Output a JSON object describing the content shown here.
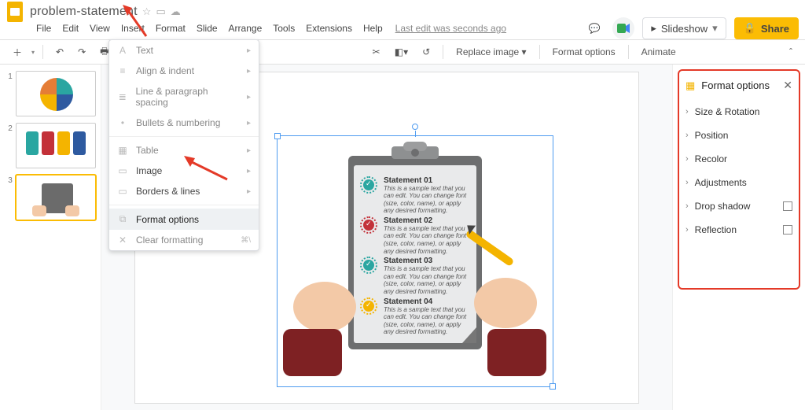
{
  "doc": {
    "title": "problem-statement",
    "last_edit": "Last edit was seconds ago"
  },
  "menubar": [
    "File",
    "Edit",
    "View",
    "Insert",
    "Format",
    "Slide",
    "Arrange",
    "Tools",
    "Extensions",
    "Help"
  ],
  "actions": {
    "slideshow": "Slideshow",
    "share": "Share"
  },
  "toolbar": {
    "replace": "Replace image",
    "format_opts": "Format options",
    "animate": "Animate"
  },
  "dropdown": {
    "text": "Text",
    "align": "Align & indent",
    "line": "Line & paragraph spacing",
    "bullets": "Bullets & numbering",
    "table": "Table",
    "image": "Image",
    "borders": "Borders & lines",
    "format_options": "Format options",
    "clear": "Clear formatting",
    "clear_shortcut": "⌘\\"
  },
  "panel": {
    "title": "Format options",
    "size": "Size & Rotation",
    "position": "Position",
    "recolor": "Recolor",
    "adjust": "Adjustments",
    "shadow": "Drop shadow",
    "reflection": "Reflection"
  },
  "slide": {
    "sample": "This is a sample text that you can edit. You can change font (size, color, name), or apply any desired formatting.",
    "s1": {
      "title": "Statement 01",
      "color": "#2aa6a1"
    },
    "s2": {
      "title": "Statement 02",
      "color": "#c33139"
    },
    "s3": {
      "title": "Statement 03",
      "color": "#2aa6a1"
    },
    "s4": {
      "title": "Statement 04",
      "color": "#f4b400"
    }
  },
  "thumbs": [
    "1",
    "2",
    "3"
  ]
}
